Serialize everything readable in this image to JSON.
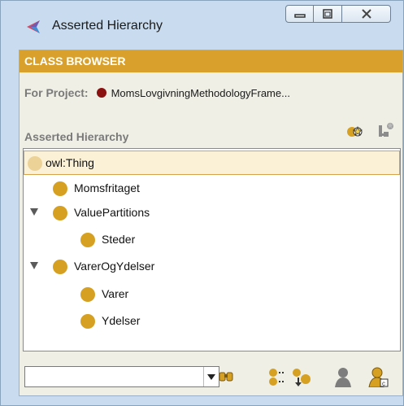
{
  "window": {
    "title": "Asserted Hierarchy",
    "controls": [
      "minimize",
      "restore",
      "close"
    ]
  },
  "class_browser": {
    "header": "CLASS BROWSER",
    "project_label": "For Project:",
    "project_name": "MomsLovgivningMethodologyFrame...",
    "section_title": "Asserted Hierarchy",
    "tools": [
      "create-subclass-icon",
      "create-sibling-icon"
    ]
  },
  "tree": {
    "rows": [
      {
        "label": "owl:Thing",
        "selected": true,
        "expanded": null
      },
      {
        "label": "Momsfritaget",
        "selected": false,
        "expanded": null
      },
      {
        "label": "ValuePartitions",
        "selected": false,
        "expanded": true
      },
      {
        "label": "Steder",
        "selected": false,
        "expanded": null
      },
      {
        "label": "VarerOgYdelser",
        "selected": false,
        "expanded": true
      },
      {
        "label": "Varer",
        "selected": false,
        "expanded": null
      },
      {
        "label": "Ydelser",
        "selected": false,
        "expanded": null
      }
    ]
  },
  "search": {
    "value": "",
    "bottom_tools": [
      "find-icon",
      "add-subclass-icon",
      "move-down-icon",
      "person-icon",
      "person-key-icon"
    ]
  },
  "colors": {
    "accent": "#d9a12b",
    "bullet": "#d6a022",
    "project_dot": "#8b1010"
  }
}
